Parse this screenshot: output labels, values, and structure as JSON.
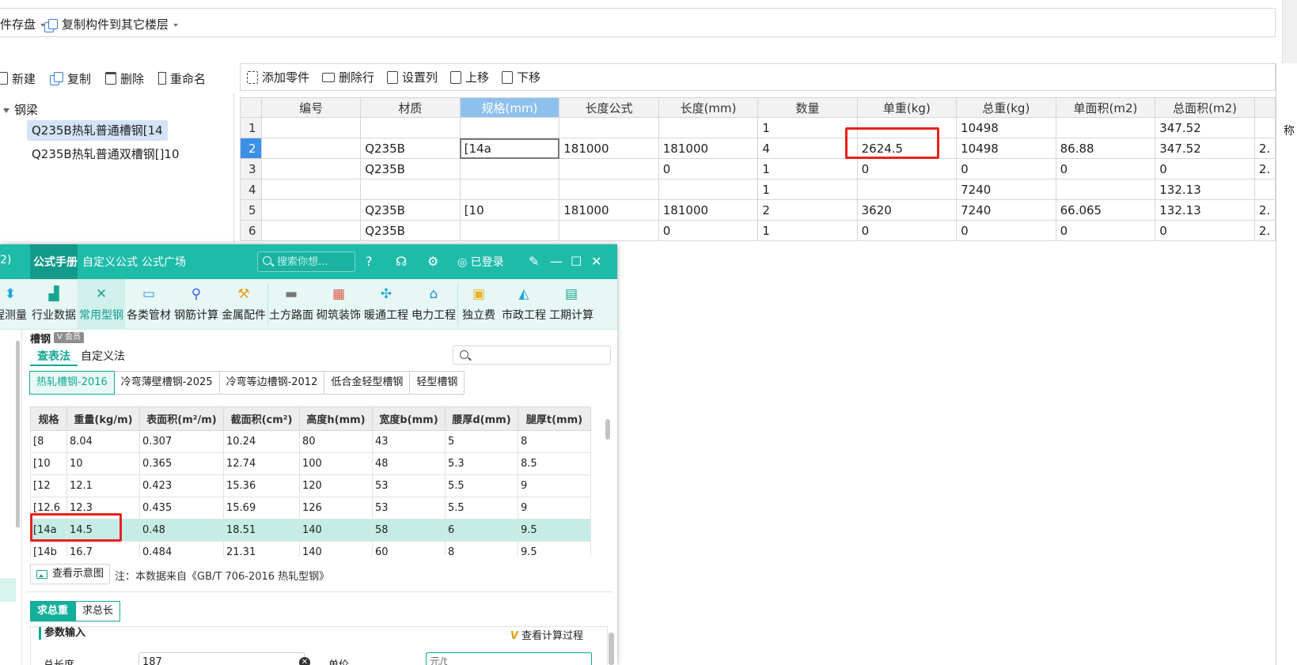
{
  "top_toolbar": {
    "save_label": "件存盘",
    "copy_label": "复制构件到其它楼层"
  },
  "left_toolbar": {
    "new_label": "新建",
    "copy_label": "复制",
    "delete_label": "删除",
    "rename_label": "重命名"
  },
  "tree": {
    "root": "钢梁",
    "items": [
      {
        "label": "Q235B热轧普通槽钢[14",
        "selected": true
      },
      {
        "label": "Q235B热轧普通双槽钢[]10",
        "selected": false
      }
    ]
  },
  "grid_toolbar": {
    "add_part_label": "添加零件",
    "delete_row_label": "删除行",
    "set_column_label": "设置列",
    "move_up_label": "上移",
    "move_down_label": "下移"
  },
  "grid": {
    "columns": [
      "编号",
      "材质",
      "规格(mm)",
      "长度公式",
      "长度(mm)",
      "数量",
      "单重(kg)",
      "总重(kg)",
      "单面积(m2)",
      "总面积(m2)",
      ""
    ],
    "active_column": "规格(mm)",
    "rows": [
      {
        "n": "1",
        "cells": [
          "",
          "",
          "",
          "",
          "",
          "1",
          "",
          "10498",
          "",
          "347.52",
          ""
        ]
      },
      {
        "n": "2",
        "cells": [
          "",
          "Q235B",
          "[14a",
          "181000",
          "181000",
          "4",
          "2624.5",
          "10498",
          "86.88",
          "347.52",
          "2."
        ]
      },
      {
        "n": "3",
        "cells": [
          "",
          "Q235B",
          "",
          "",
          "0",
          "1",
          "0",
          "0",
          "0",
          "0",
          "2."
        ]
      },
      {
        "n": "4",
        "cells": [
          "",
          "",
          "",
          "",
          "",
          "1",
          "",
          "7240",
          "",
          "132.13",
          ""
        ]
      },
      {
        "n": "5",
        "cells": [
          "",
          "Q235B",
          "[10",
          "181000",
          "181000",
          "2",
          "3620",
          "7240",
          "66.065",
          "132.13",
          "2."
        ]
      },
      {
        "n": "6",
        "cells": [
          "",
          "Q235B",
          "",
          "",
          "0",
          "1",
          "0",
          "0",
          "0",
          "0",
          "2."
        ]
      }
    ],
    "current_row": "2",
    "red_values": [
      "3620",
      "7240"
    ],
    "side_cut_label": "称"
  },
  "formula_window": {
    "title_prefix": "2)",
    "tabs": [
      "公式手册",
      "自定义公式",
      "公式广场"
    ],
    "active_tab": "公式手册",
    "search_placeholder": "搜索你想...",
    "login_label": "已登录",
    "categories": [
      {
        "label": "程测量",
        "icon": "survey-icon",
        "color": "#1ea7d6"
      },
      {
        "label": "行业数据",
        "icon": "chart-icon",
        "color": "#18a58f"
      },
      {
        "label": "常用型钢",
        "icon": "tools-icon",
        "color": "#18a58f",
        "active": true
      },
      {
        "label": "各类管材",
        "icon": "pipe-icon",
        "color": "#3a8ee6"
      },
      {
        "label": "钢筋计算",
        "icon": "rebar-icon",
        "color": "#3a5ee6"
      },
      {
        "label": "金属配件",
        "icon": "fitting-icon",
        "color": "#e6a21e"
      },
      {
        "label": "土方路面",
        "icon": "road-icon",
        "color": "#777777"
      },
      {
        "label": "砌筑装饰",
        "icon": "brick-icon",
        "color": "#e05a4a"
      },
      {
        "label": "暖通工程",
        "icon": "fan-icon",
        "color": "#1ea7d6"
      },
      {
        "label": "电力工程",
        "icon": "power-icon",
        "color": "#1e8fd6"
      },
      {
        "label": "独立费",
        "icon": "fee-icon",
        "color": "#e6b21e"
      },
      {
        "label": "市政工程",
        "icon": "municipal-icon",
        "color": "#1ea7d6"
      },
      {
        "label": "工期计算",
        "icon": "calendar-icon",
        "color": "#18a58f"
      }
    ],
    "channel": {
      "title": "槽钢",
      "badge": "V 会员",
      "modes": [
        "查表法",
        "自定义法"
      ],
      "active_mode": "查表法"
    },
    "standards": [
      "热轧槽钢-2016",
      "冷弯薄壁槽钢-2025",
      "冷弯等边槽钢-2012",
      "低合金轻型槽钢",
      "轻型槽钢"
    ],
    "active_standard": "热轧槽钢-2016",
    "spec_table": {
      "columns": [
        "规格",
        "重量(kg/m)",
        "表面积(m²/m)",
        "截面积(cm²)",
        "高度h(mm)",
        "宽度b(mm)",
        "腰厚d(mm)",
        "腿厚t(mm)"
      ],
      "rows": [
        [
          "[8",
          "8.04",
          "0.307",
          "10.24",
          "80",
          "43",
          "5",
          "8"
        ],
        [
          "[10",
          "10",
          "0.365",
          "12.74",
          "100",
          "48",
          "5.3",
          "8.5"
        ],
        [
          "[12",
          "12.1",
          "0.423",
          "15.36",
          "120",
          "53",
          "5.5",
          "9"
        ],
        [
          "[12.6",
          "12.3",
          "0.435",
          "15.69",
          "126",
          "53",
          "5.5",
          "9"
        ],
        [
          "[14a",
          "14.5",
          "0.48",
          "18.51",
          "140",
          "58",
          "6",
          "9.5"
        ],
        [
          "[14b",
          "16.7",
          "0.484",
          "21.31",
          "140",
          "60",
          "8",
          "9.5"
        ]
      ],
      "highlighted_row": "[14a"
    },
    "diagram_button": "查看示意图",
    "note": "注：本数据来自《GB/T 706-2016 热轧型钢》",
    "calc_tabs": [
      "求总重",
      "求总长"
    ],
    "active_calc": "求总重",
    "param_section": "参数输入",
    "view_calc_label": "查看计算过程",
    "params": {
      "total_length_label": "总长度",
      "total_length_value": "187",
      "unit_price_label": "单价",
      "unit_price_placeholder": "元/t"
    }
  },
  "colors": {
    "accent": "#1ebba9",
    "grid_header_active": "#8ec0ee",
    "current_row": "#3d8fe8",
    "highlight_red": "#e8201d",
    "spec_highlight": "#c5ede6"
  }
}
